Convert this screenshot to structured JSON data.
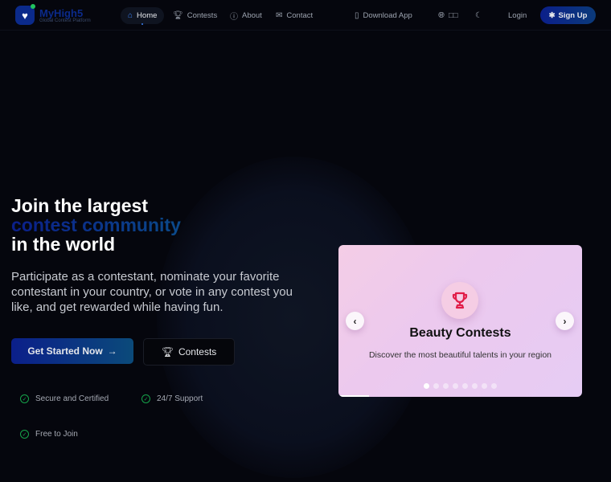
{
  "brand": {
    "name": "MyHigh5",
    "tagline": "Global Contest Platform"
  },
  "nav": {
    "items": [
      {
        "label": "Home",
        "icon": "home-icon",
        "active": true
      },
      {
        "label": "Contests",
        "icon": "trophy-icon"
      },
      {
        "label": "About",
        "icon": "info-icon"
      },
      {
        "label": "Contact",
        "icon": "mail-icon"
      }
    ],
    "download": "Download App",
    "language": "□□",
    "login": "Login",
    "signup": "Sign Up"
  },
  "hero": {
    "title_line1": "Join the largest",
    "title_highlight": "contest community",
    "title_line3": "in the world",
    "description": "Participate as a contestant, nominate your favorite contestant in your country, or vote in any contest you like, and get rewarded while having fun.",
    "primary_cta": "Get Started Now",
    "secondary_cta": "Contests",
    "features": [
      "Secure and Certified",
      "24/7 Support",
      "Free to Join"
    ]
  },
  "carousel": {
    "title": "Beauty Contests",
    "subtitle": "Discover the most beautiful talents in your region",
    "slide_count": 8,
    "active_index": 0,
    "accent": "#e11d48"
  }
}
